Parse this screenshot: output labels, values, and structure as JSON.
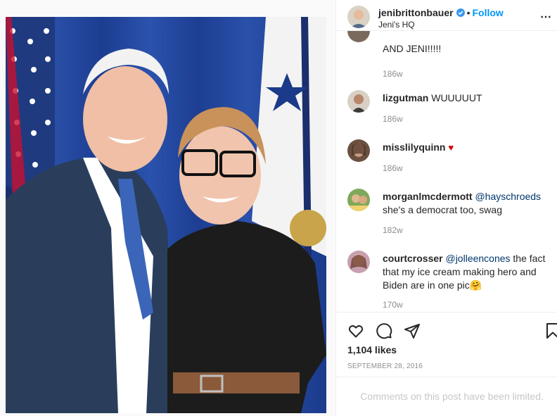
{
  "post": {
    "image_alt": "Photo of two people smiling in front of flags",
    "likes": "1,104 likes",
    "date": "SEPTEMBER 28, 2016",
    "comments_limited": "Comments on this post have been limited."
  },
  "header": {
    "username": "jenibrittonbauer",
    "separator": "•",
    "follow_label": "Follow",
    "location": "Jeni's HQ",
    "more_label": "⋯"
  },
  "comments": [
    {
      "username": "",
      "text": "AND JENI!!!!!",
      "time": "186w"
    },
    {
      "username": "lizgutman",
      "text": "WUUUUUT",
      "time": "186w"
    },
    {
      "username": "misslilyquinn",
      "text": "",
      "emoji": "♥",
      "time": "186w"
    },
    {
      "username": "morganlmcdermott",
      "mention": "@hayschroeds",
      "text": "she's a democrat too, swag",
      "time": "182w"
    },
    {
      "username": "courtcrosser",
      "mention": "@jolleencones",
      "text": "the fact that my ice cream making hero and Biden are in one pic",
      "emoji": "🤗",
      "time": "170w"
    }
  ],
  "icons": {
    "like": "heart-icon",
    "comment": "comment-icon",
    "share": "share-icon",
    "save": "bookmark-icon",
    "verified": "verified-badge-icon"
  },
  "colors": {
    "link": "#0095f6",
    "mention": "#00376b",
    "muted": "#8e8e8e",
    "verified": "#3897f0"
  }
}
